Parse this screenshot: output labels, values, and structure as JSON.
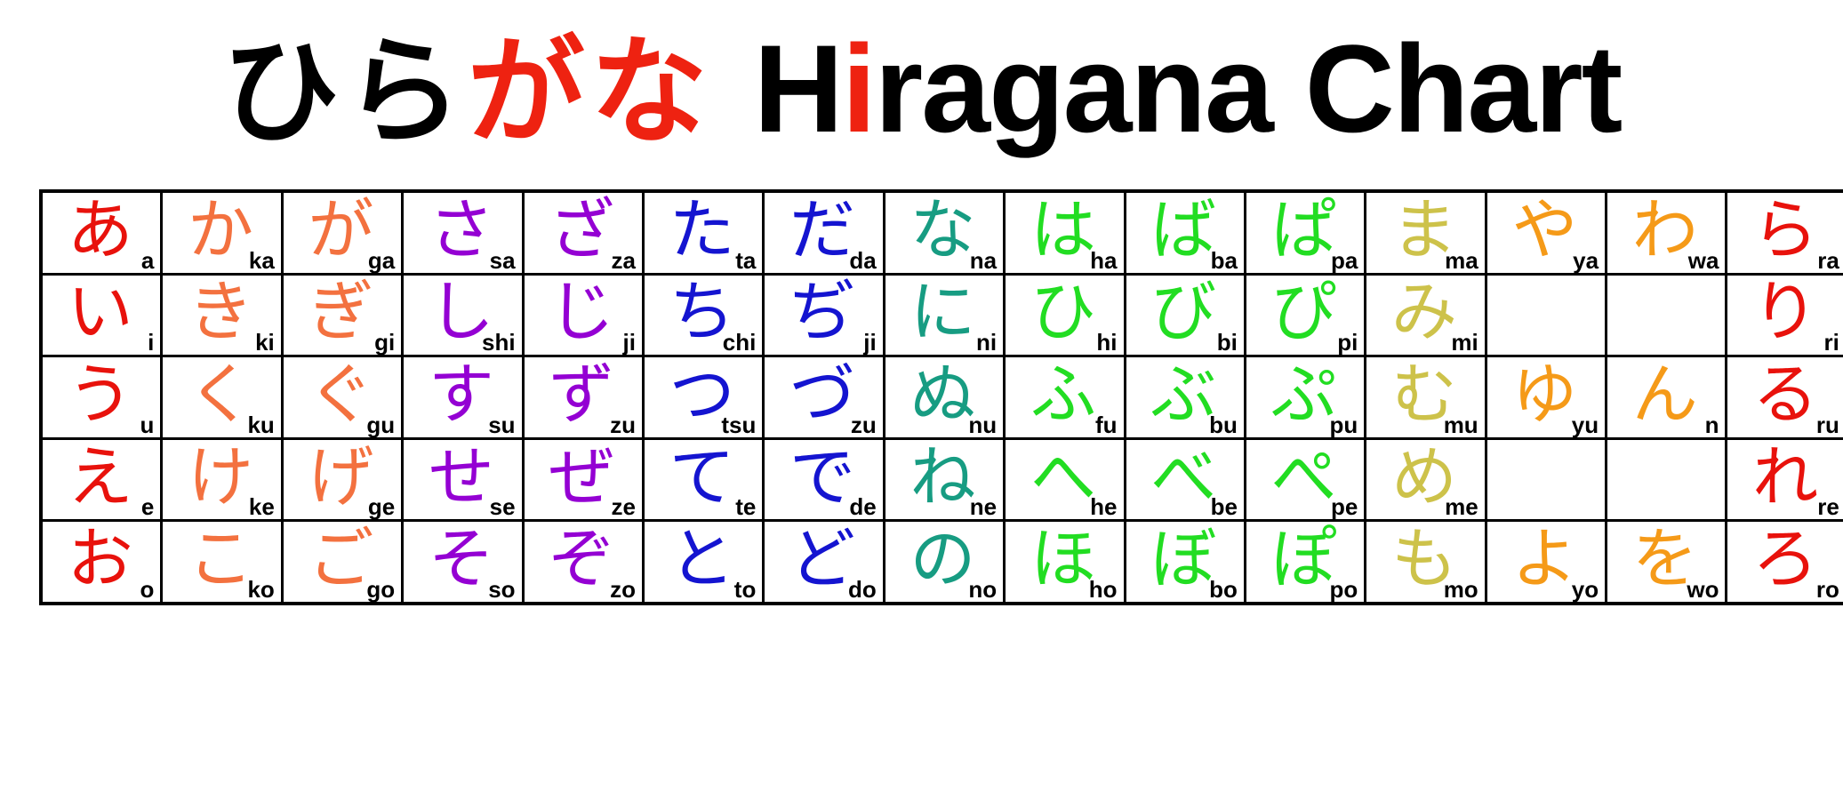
{
  "title": {
    "kana_before": "ひら",
    "kana_accent_1": "が",
    "kana_after": "",
    "kana_accent_2": "な",
    "kana_full": "ひらがな",
    "latin_h": "H",
    "latin_i": "i",
    "latin_rest": "ragana Chart",
    "latin_full": "Hiragana Chart",
    "accent_color": "#ee2211"
  },
  "colors": {
    "a": "#e8120c",
    "ka": "#f3713f",
    "ga": "#f3713f",
    "sa": "#9400d3",
    "za": "#9400d3",
    "ta": "#1414d0",
    "da": "#1414d0",
    "na": "#179c82",
    "ha": "#22dd22",
    "ba": "#22dd22",
    "pa": "#22dd22",
    "ma": "#cdc24a",
    "ya": "#f59a18",
    "wa": "#f59a18",
    "ra": "#e8120c",
    "border": "#000000",
    "background": "#ffffff",
    "romaji": "#000000"
  },
  "chart_data": {
    "type": "table",
    "title": "ひらがな Hiragana Chart",
    "columns": [
      "a",
      "ka",
      "ga",
      "sa",
      "za",
      "ta",
      "da",
      "na",
      "ha",
      "ba",
      "pa",
      "ma",
      "ya",
      "wa",
      "ra"
    ],
    "rows": [
      "a",
      "i",
      "u",
      "e",
      "o"
    ],
    "grid": [
      [
        {
          "kana": "あ",
          "romaji": "a",
          "color_key": "a"
        },
        {
          "kana": "か",
          "romaji": "ka",
          "color_key": "ka"
        },
        {
          "kana": "が",
          "romaji": "ga",
          "color_key": "ga"
        },
        {
          "kana": "さ",
          "romaji": "sa",
          "color_key": "sa"
        },
        {
          "kana": "ざ",
          "romaji": "za",
          "color_key": "za"
        },
        {
          "kana": "た",
          "romaji": "ta",
          "color_key": "ta"
        },
        {
          "kana": "だ",
          "romaji": "da",
          "color_key": "da"
        },
        {
          "kana": "な",
          "romaji": "na",
          "color_key": "na"
        },
        {
          "kana": "は",
          "romaji": "ha",
          "color_key": "ha"
        },
        {
          "kana": "ば",
          "romaji": "ba",
          "color_key": "ba"
        },
        {
          "kana": "ぱ",
          "romaji": "pa",
          "color_key": "pa"
        },
        {
          "kana": "ま",
          "romaji": "ma",
          "color_key": "ma"
        },
        {
          "kana": "や",
          "romaji": "ya",
          "color_key": "ya"
        },
        {
          "kana": "わ",
          "romaji": "wa",
          "color_key": "wa"
        },
        {
          "kana": "ら",
          "romaji": "ra",
          "color_key": "ra"
        }
      ],
      [
        {
          "kana": "い",
          "romaji": "i",
          "color_key": "a"
        },
        {
          "kana": "き",
          "romaji": "ki",
          "color_key": "ka"
        },
        {
          "kana": "ぎ",
          "romaji": "gi",
          "color_key": "ga"
        },
        {
          "kana": "し",
          "romaji": "shi",
          "color_key": "sa"
        },
        {
          "kana": "じ",
          "romaji": "ji",
          "color_key": "za"
        },
        {
          "kana": "ち",
          "romaji": "chi",
          "color_key": "ta"
        },
        {
          "kana": "ぢ",
          "romaji": "ji",
          "color_key": "da"
        },
        {
          "kana": "に",
          "romaji": "ni",
          "color_key": "na"
        },
        {
          "kana": "ひ",
          "romaji": "hi",
          "color_key": "ha"
        },
        {
          "kana": "び",
          "romaji": "bi",
          "color_key": "ba"
        },
        {
          "kana": "ぴ",
          "romaji": "pi",
          "color_key": "pa"
        },
        {
          "kana": "み",
          "romaji": "mi",
          "color_key": "ma"
        },
        {
          "kana": "",
          "romaji": "",
          "color_key": "ya"
        },
        {
          "kana": "",
          "romaji": "",
          "color_key": "wa"
        },
        {
          "kana": "り",
          "romaji": "ri",
          "color_key": "ra"
        }
      ],
      [
        {
          "kana": "う",
          "romaji": "u",
          "color_key": "a"
        },
        {
          "kana": "く",
          "romaji": "ku",
          "color_key": "ka"
        },
        {
          "kana": "ぐ",
          "romaji": "gu",
          "color_key": "ga"
        },
        {
          "kana": "す",
          "romaji": "su",
          "color_key": "sa"
        },
        {
          "kana": "ず",
          "romaji": "zu",
          "color_key": "za"
        },
        {
          "kana": "つ",
          "romaji": "tsu",
          "color_key": "ta"
        },
        {
          "kana": "づ",
          "romaji": "zu",
          "color_key": "da"
        },
        {
          "kana": "ぬ",
          "romaji": "nu",
          "color_key": "na"
        },
        {
          "kana": "ふ",
          "romaji": "fu",
          "color_key": "ha"
        },
        {
          "kana": "ぶ",
          "romaji": "bu",
          "color_key": "ba"
        },
        {
          "kana": "ぷ",
          "romaji": "pu",
          "color_key": "pa"
        },
        {
          "kana": "む",
          "romaji": "mu",
          "color_key": "ma"
        },
        {
          "kana": "ゆ",
          "romaji": "yu",
          "color_key": "ya"
        },
        {
          "kana": "ん",
          "romaji": "n",
          "color_key": "wa"
        },
        {
          "kana": "る",
          "romaji": "ru",
          "color_key": "ra"
        }
      ],
      [
        {
          "kana": "え",
          "romaji": "e",
          "color_key": "a"
        },
        {
          "kana": "け",
          "romaji": "ke",
          "color_key": "ka"
        },
        {
          "kana": "げ",
          "romaji": "ge",
          "color_key": "ga"
        },
        {
          "kana": "せ",
          "romaji": "se",
          "color_key": "sa"
        },
        {
          "kana": "ぜ",
          "romaji": "ze",
          "color_key": "za"
        },
        {
          "kana": "て",
          "romaji": "te",
          "color_key": "ta"
        },
        {
          "kana": "で",
          "romaji": "de",
          "color_key": "da"
        },
        {
          "kana": "ね",
          "romaji": "ne",
          "color_key": "na"
        },
        {
          "kana": "へ",
          "romaji": "he",
          "color_key": "ha"
        },
        {
          "kana": "べ",
          "romaji": "be",
          "color_key": "ba"
        },
        {
          "kana": "ぺ",
          "romaji": "pe",
          "color_key": "pa"
        },
        {
          "kana": "め",
          "romaji": "me",
          "color_key": "ma"
        },
        {
          "kana": "",
          "romaji": "",
          "color_key": "ya"
        },
        {
          "kana": "",
          "romaji": "",
          "color_key": "wa"
        },
        {
          "kana": "れ",
          "romaji": "re",
          "color_key": "ra"
        }
      ],
      [
        {
          "kana": "お",
          "romaji": "o",
          "color_key": "a"
        },
        {
          "kana": "こ",
          "romaji": "ko",
          "color_key": "ka"
        },
        {
          "kana": "ご",
          "romaji": "go",
          "color_key": "ga"
        },
        {
          "kana": "そ",
          "romaji": "so",
          "color_key": "sa"
        },
        {
          "kana": "ぞ",
          "romaji": "zo",
          "color_key": "za"
        },
        {
          "kana": "と",
          "romaji": "to",
          "color_key": "ta"
        },
        {
          "kana": "ど",
          "romaji": "do",
          "color_key": "da"
        },
        {
          "kana": "の",
          "romaji": "no",
          "color_key": "na"
        },
        {
          "kana": "ほ",
          "romaji": "ho",
          "color_key": "ha"
        },
        {
          "kana": "ぼ",
          "romaji": "bo",
          "color_key": "ba"
        },
        {
          "kana": "ぽ",
          "romaji": "po",
          "color_key": "pa"
        },
        {
          "kana": "も",
          "romaji": "mo",
          "color_key": "ma"
        },
        {
          "kana": "よ",
          "romaji": "yo",
          "color_key": "ya"
        },
        {
          "kana": "を",
          "romaji": "wo",
          "color_key": "wa"
        },
        {
          "kana": "ろ",
          "romaji": "ro",
          "color_key": "ra"
        }
      ]
    ]
  }
}
